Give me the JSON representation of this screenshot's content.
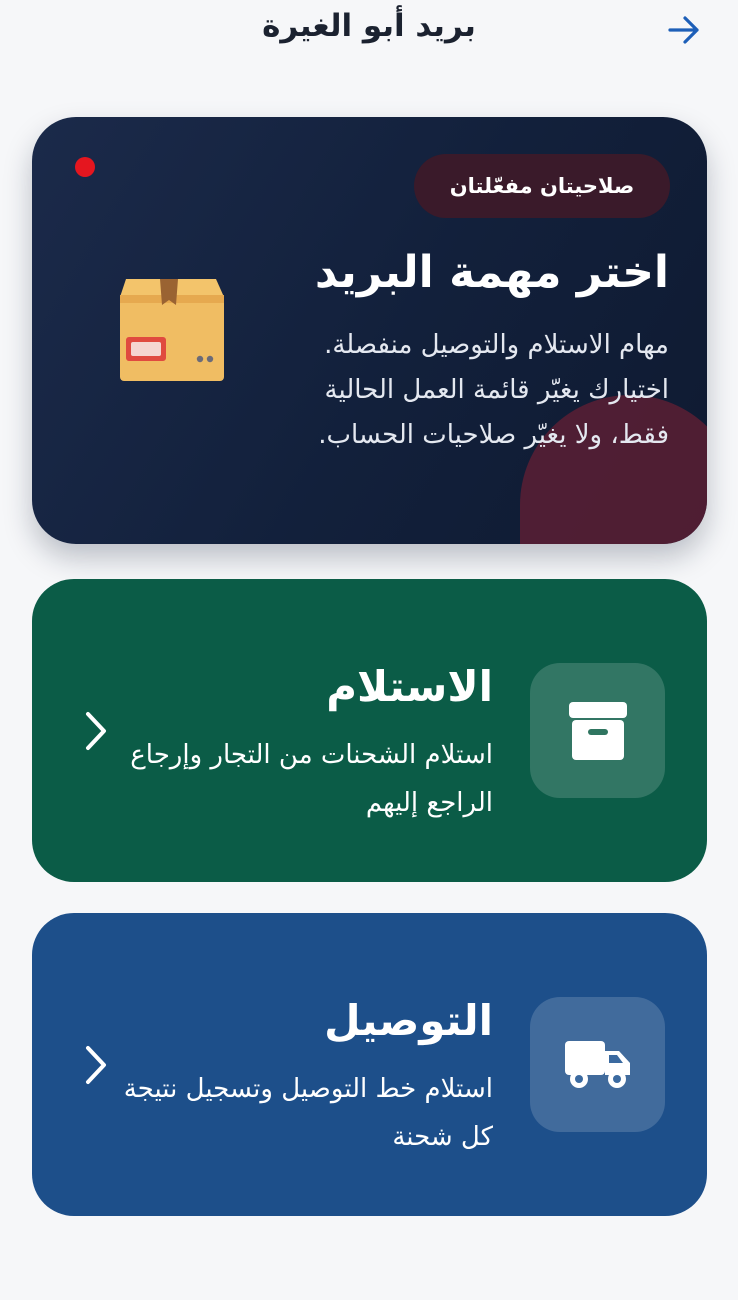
{
  "header": {
    "title": "بريد أبو الغيرة",
    "back_icon": "arrow-right-icon"
  },
  "hero": {
    "badge": "صلاحيتان مفعّلتان",
    "title": "اختر مهمة البريد",
    "description": "مهام الاستلام والتوصيل منفصلة. اختيارك يغيّر قائمة العمل الحالية فقط، ولا يغيّر صلاحيات الحساب.",
    "icon": "package-box-icon",
    "status_dot_color": "#e5161f"
  },
  "tasks": [
    {
      "title": "الاستلام",
      "description": "استلام الشحنات من التجار وإرجاع الراجع إليهم",
      "icon": "archive-box-icon",
      "color": "#0b5c47"
    },
    {
      "title": "التوصيل",
      "description": "استلام خط التوصيل وتسجيل نتيجة كل شحنة",
      "icon": "truck-icon",
      "color": "#1d4f8a"
    }
  ],
  "colors": {
    "accent": "#1d5fb8",
    "hero_bg": "#12203b",
    "badge_bg": "#3a1a2a"
  }
}
